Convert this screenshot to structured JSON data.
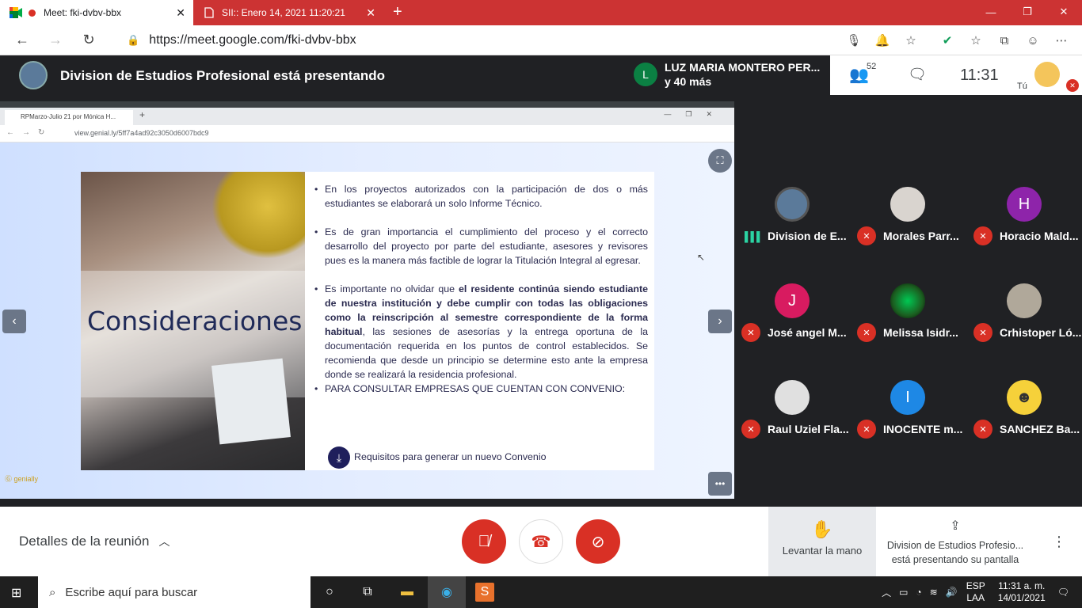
{
  "browser": {
    "tabs": [
      {
        "title": "Meet: fki-dvbv-bbx",
        "active": true
      },
      {
        "title": "SII:: Enero 14, 2021 11:20:21",
        "active": false
      }
    ],
    "url_host": "https://meet.google.com",
    "url_path": "/fki-dvbv-bbx",
    "extension_badge": "0"
  },
  "meet": {
    "presenting_text": "Division de Estudios Profesional está presentando",
    "chat": {
      "avatar_letter": "L",
      "line1": "LUZ MARIA MONTERO PER...",
      "line2": "y 40 más"
    },
    "participant_count": "52",
    "time": "11:31",
    "self_label": "Tú"
  },
  "shared_screen": {
    "inner_tab": "RPMarzo-Julio 21 por Mónica H...",
    "inner_url": "view.genial.ly/5ff7a4ad92c3050d6007bdc9",
    "slide_title": "Consideraciones",
    "bullet1": "En los proyectos autorizados con la participación de dos o más estudiantes se elaborará un solo Informe Técnico.",
    "bullet2": "Es de gran importancia el cumplimiento del proceso y el correcto desarrollo del proyecto por parte del estudiante, asesores y revisores pues es la manera más factible de lograr la Titulación Integral al egresar.",
    "bullet3_a": "Es importante no olvidar que ",
    "bullet3_b": "el residente continúa siendo estudiante de nuestra institución y debe cumplir con todas las obligaciones como la reinscripción al semestre correspondiente de la forma habitual",
    "bullet3_c": ", las sesiones de asesorías y la entrega oportuna de la documentación requerida en los puntos de control establecidos. Se recomienda que desde un principio se determine esto ante la empresa donde se realizará la residencia profesional.",
    "bullet4": "PARA CONSULTAR EMPRESAS QUE CUENTAN CON CONVENIO:",
    "download_link": "Requisitos para generar un nuevo Convenio",
    "genially_brand": "genially"
  },
  "participants": [
    {
      "name": "Division de E...",
      "avatar": "",
      "muted": false,
      "speaking": true,
      "color": "#5b7a9a"
    },
    {
      "name": "Morales Parr...",
      "avatar": "",
      "muted": true,
      "color": "#d9d4cf"
    },
    {
      "name": "Horacio Mald...",
      "avatar": "H",
      "muted": true,
      "color": "#8e24aa"
    },
    {
      "name": "José angel M...",
      "avatar": "J",
      "muted": true,
      "color": "#d81b60"
    },
    {
      "name": "Melissa Isidr...",
      "avatar": "",
      "muted": true,
      "color": "#2e7d32"
    },
    {
      "name": "Crhistoper Ló...",
      "avatar": "",
      "muted": true,
      "color": "#b0a89a"
    },
    {
      "name": "Raul Uziel Fla...",
      "avatar": "",
      "muted": true,
      "color": "#e0e0e0"
    },
    {
      "name": "INOCENTE m...",
      "avatar": "I",
      "muted": true,
      "color": "#1e88e5"
    },
    {
      "name": "SANCHEZ Ba...",
      "avatar": "",
      "muted": true,
      "color": "#f6d13a"
    }
  ],
  "bottom": {
    "details": "Detalles de la reunión",
    "raise_hand": "Levantar la mano",
    "presenting_line1": "Division de Estudios Profesio...",
    "presenting_line2": "está presentando su pantalla"
  },
  "taskbar": {
    "search_placeholder": "Escribe aquí para buscar",
    "lang1": "ESP",
    "lang2": "LAA",
    "time": "11:31 a. m.",
    "date": "14/01/2021"
  },
  "colors": {
    "accent_red": "#d93025",
    "chrome_red": "#cc3333",
    "meet_dark": "#202124"
  }
}
